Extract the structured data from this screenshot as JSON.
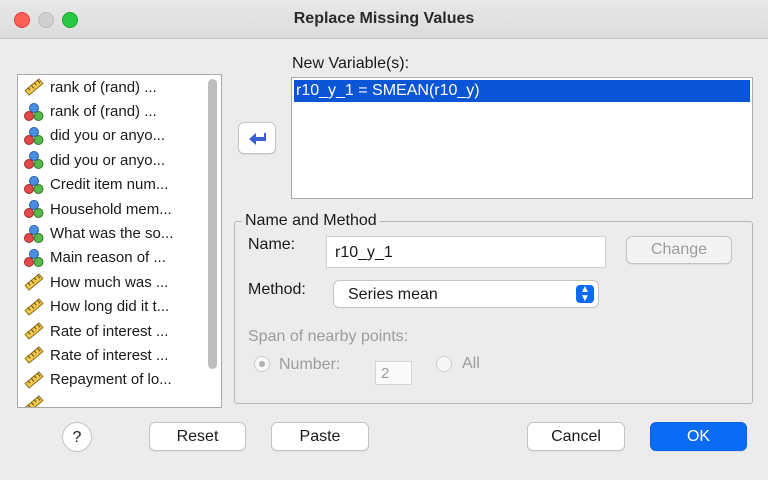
{
  "window": {
    "title": "Replace Missing Values"
  },
  "variables": [
    {
      "label": "rank of (rand)    ...",
      "icon": "scale-ruler-icon"
    },
    {
      "label": "rank of (rand)    ...",
      "icon": "nominal-balls-icon"
    },
    {
      "label": "did you or anyo...",
      "icon": "nominal-balls-icon"
    },
    {
      "label": "did you or anyo...",
      "icon": "nominal-balls-icon"
    },
    {
      "label": "Credit item num...",
      "icon": "nominal-balls-icon"
    },
    {
      "label": "Household mem...",
      "icon": "nominal-balls-icon"
    },
    {
      "label": "What was the so...",
      "icon": "nominal-balls-icon"
    },
    {
      "label": "Main reason of ...",
      "icon": "nominal-balls-icon"
    },
    {
      "label": "How much was ...",
      "icon": "scale-ruler-icon"
    },
    {
      "label": "How long did it t...",
      "icon": "scale-ruler-icon"
    },
    {
      "label": "Rate of interest ...",
      "icon": "scale-ruler-icon"
    },
    {
      "label": "Rate of interest ...",
      "icon": "scale-ruler-icon"
    },
    {
      "label": "Repayment of lo...",
      "icon": "scale-ruler-icon"
    },
    {
      "label": "",
      "icon": "scale-ruler-icon"
    }
  ],
  "new_variables": {
    "label": "New Variable(s):",
    "items": [
      "r10_y_1 = SMEAN(r10_y)"
    ]
  },
  "name_method": {
    "group_title": "Name and Method",
    "name_label": "Name:",
    "name_value": "r10_y_1",
    "change_label": "Change",
    "method_label": "Method:",
    "method_value": "Series mean",
    "span_label": "Span of nearby points:",
    "number_label": "Number:",
    "number_value": "2",
    "all_label": "All"
  },
  "buttons": {
    "help": "?",
    "reset": "Reset",
    "paste": "Paste",
    "cancel": "Cancel",
    "ok": "OK"
  },
  "colors": {
    "selection": "#0a55d6",
    "primary": "#0a6cf5",
    "close": "#fe5f57",
    "maximize": "#28c840"
  }
}
